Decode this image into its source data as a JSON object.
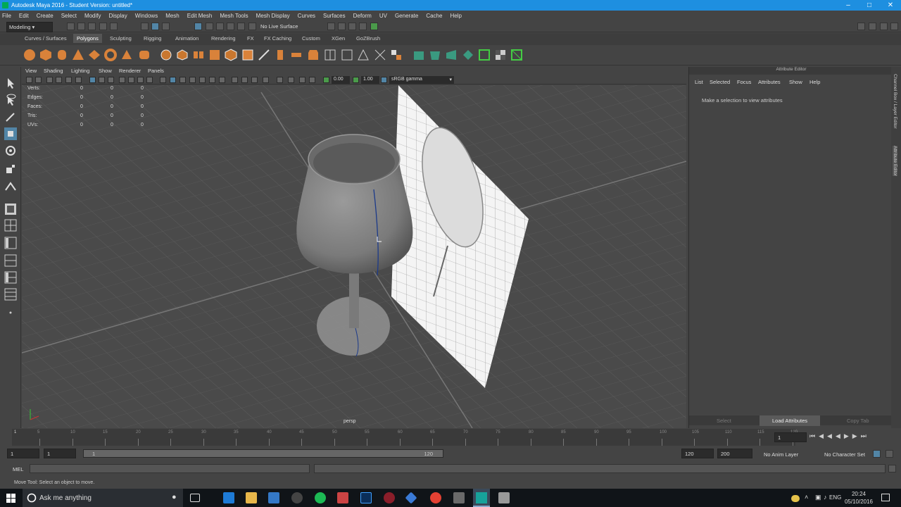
{
  "window": {
    "title": "Autodesk Maya 2016 - Student Version: untitled*"
  },
  "menubar": [
    "File",
    "Edit",
    "Create",
    "Select",
    "Modify",
    "Display",
    "Windows",
    "Mesh",
    "Edit Mesh",
    "Mesh Tools",
    "Mesh Display",
    "Curves",
    "Surfaces",
    "Deform",
    "UV",
    "Generate",
    "Cache",
    "Help"
  ],
  "statusline": {
    "menuset": "Modeling",
    "live_surface": "No Live Surface"
  },
  "shelf_tabs": [
    "Curves / Surfaces",
    "Polygons",
    "Sculpting",
    "Rigging",
    "Animation",
    "Rendering",
    "FX",
    "FX Caching",
    "Custom",
    "XGen",
    "GoZBrush"
  ],
  "shelf_active_tab": "Polygons",
  "panel_menu": [
    "View",
    "Shading",
    "Lighting",
    "Show",
    "Renderer",
    "Panels"
  ],
  "panel_toolbar": {
    "exposure": "0.00",
    "gamma": "1.00",
    "colorspace": "sRGB gamma"
  },
  "hud": {
    "rows": [
      {
        "label": "Verts:",
        "a": "0",
        "b": "0",
        "c": "0"
      },
      {
        "label": "Edges:",
        "a": "0",
        "b": "0",
        "c": "0"
      },
      {
        "label": "Faces:",
        "a": "0",
        "b": "0",
        "c": "0"
      },
      {
        "label": "Tris:",
        "a": "0",
        "b": "0",
        "c": "0"
      },
      {
        "label": "UVs:",
        "a": "0",
        "b": "0",
        "c": "0"
      }
    ]
  },
  "viewport": {
    "camera": "persp"
  },
  "attribute_editor": {
    "title": "Attribute Editor",
    "menu": [
      "List",
      "Selected",
      "Focus",
      "Attributes",
      "Show",
      "Help"
    ],
    "message": "Make a selection to view attributes",
    "buttons": [
      "Select",
      "Load Attributes",
      "Copy Tab"
    ],
    "side_tabs": [
      "Channel Box / Layer Editor",
      "Attribute Editor"
    ]
  },
  "timeslider": {
    "ticks": [
      "1",
      "5",
      "10",
      "15",
      "20",
      "25",
      "30",
      "35",
      "40",
      "45",
      "50",
      "55",
      "60",
      "65",
      "70",
      "75",
      "80",
      "85",
      "90",
      "95",
      "100",
      "105",
      "110",
      "115",
      "120"
    ],
    "current_frame": "1"
  },
  "range": {
    "start": "1",
    "inner_start": "1",
    "slider_start": "1",
    "slider_end": "120",
    "end": "120",
    "max": "200",
    "anim_layer": "No Anim Layer",
    "character_set": "No Character Set"
  },
  "cmdline": {
    "label": "MEL"
  },
  "helpline": {
    "text": "Move Tool: Select an object to move."
  },
  "taskbar": {
    "search_placeholder": "Ask me anything",
    "lang": "ENG",
    "time": "20:24",
    "date": "05/10/2016"
  }
}
